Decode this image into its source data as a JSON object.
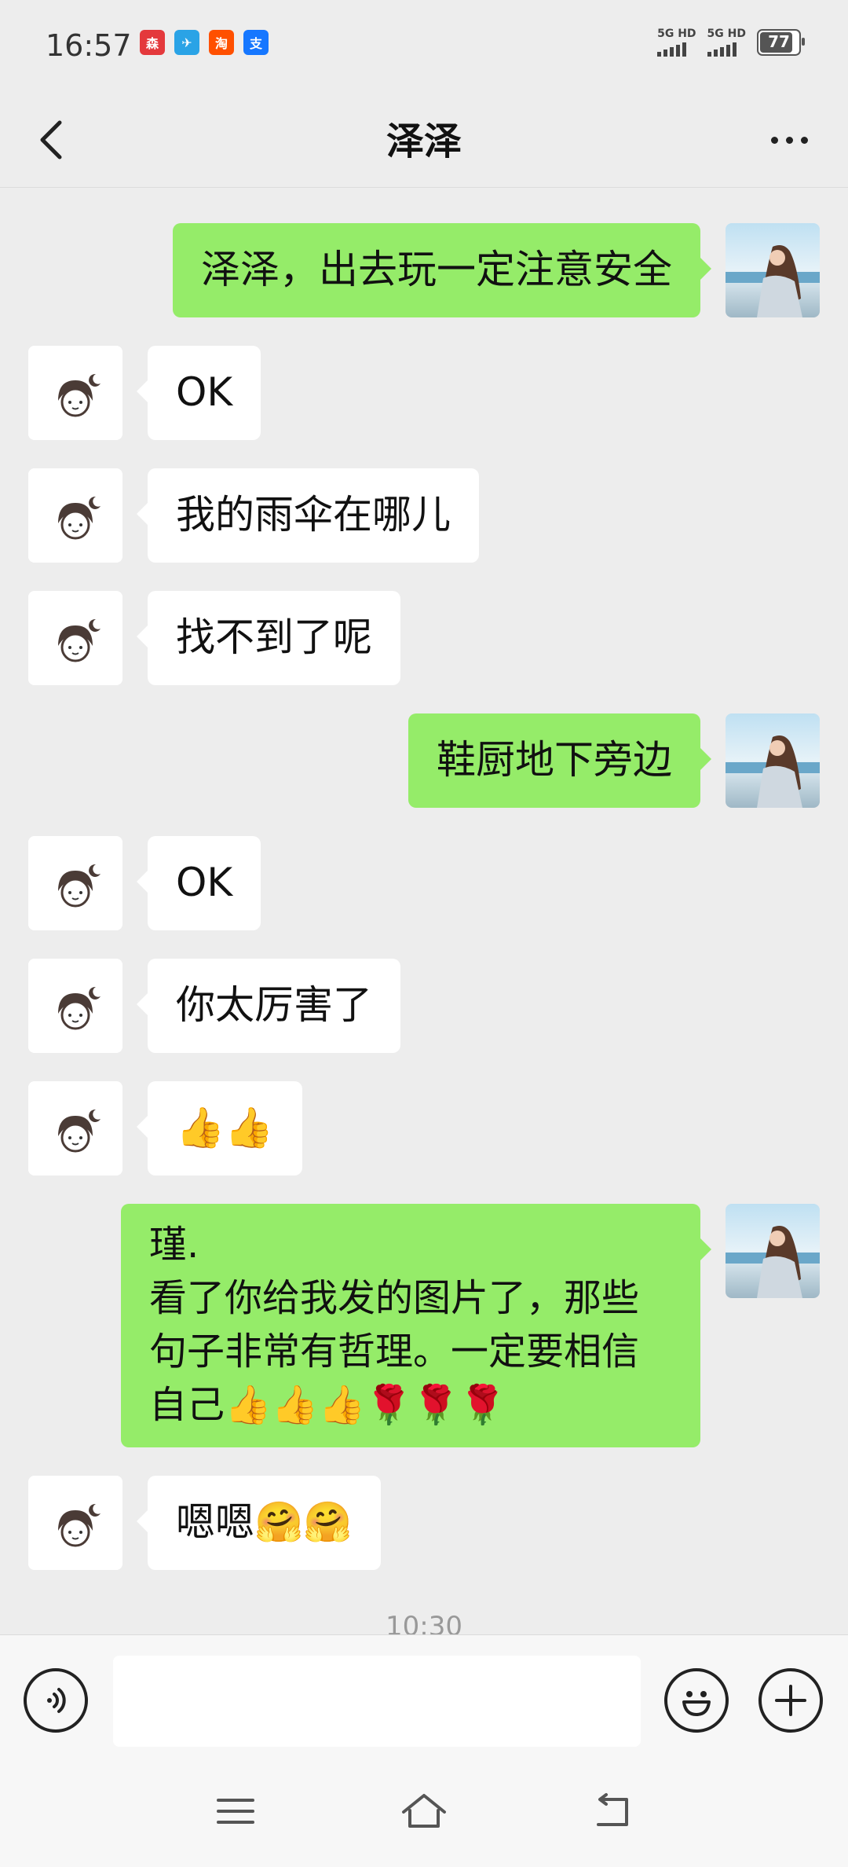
{
  "status_bar": {
    "time": "16:57",
    "app_icons": [
      {
        "name": "app-icon-red",
        "glyph": "森",
        "color": "#e4393c"
      },
      {
        "name": "app-icon-telegram",
        "glyph": "✈",
        "color": "#2aa3e6"
      },
      {
        "name": "app-icon-taobao",
        "glyph": "淘",
        "color": "#ff5000"
      },
      {
        "name": "app-icon-alipay",
        "glyph": "支",
        "color": "#1677ff"
      }
    ],
    "signal1_label": "5G HD",
    "signal2_label": "5G HD",
    "battery": "77"
  },
  "header": {
    "title": "泽泽"
  },
  "messages": [
    {
      "side": "out",
      "text": "泽泽，出去玩一定注意安全"
    },
    {
      "side": "in",
      "text": "OK"
    },
    {
      "side": "in",
      "text": "我的雨伞在哪儿"
    },
    {
      "side": "in",
      "text": "找不到了呢"
    },
    {
      "side": "out",
      "text": "鞋厨地下旁边"
    },
    {
      "side": "in",
      "text": "OK"
    },
    {
      "side": "in",
      "text": "你太厉害了"
    },
    {
      "side": "in",
      "text": "👍👍"
    },
    {
      "side": "out",
      "text": "瑾.\n看了你给我发的图片了，那些句子非常有哲理。一定要相信自己👍👍👍🌹🌹🌹"
    },
    {
      "side": "in",
      "text": "嗯嗯🤗🤗"
    }
  ],
  "timestamp": "10:30",
  "input": {
    "value": "",
    "placeholder": ""
  },
  "colors": {
    "background": "#ededed",
    "outgoing_bubble": "#95ec69",
    "incoming_bubble": "#ffffff"
  }
}
